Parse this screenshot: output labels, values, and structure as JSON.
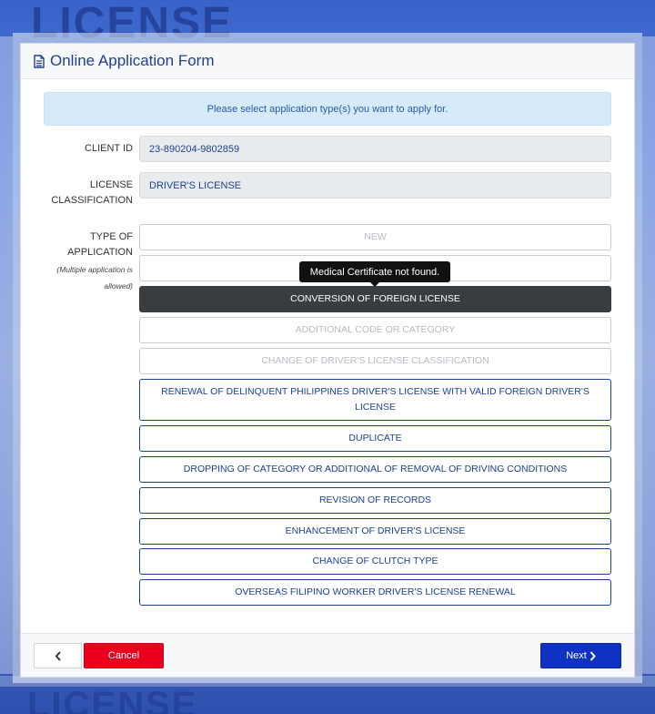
{
  "background": {
    "top_text": "LICENSE",
    "bottom_text": "LICENSE"
  },
  "form": {
    "title": "Online Application Form",
    "title_icon": "file-text-icon",
    "banner": "Please select application type(s) you want to apply for.",
    "client_id_label": "CLIENT ID",
    "client_id_value": "23-890204-9802859",
    "classification_label_1": "LICENSE",
    "classification_label_2": "CLASSIFICATION",
    "classification_value": "DRIVER'S LICENSE",
    "type_label_1": "TYPE OF",
    "type_label_2": "APPLICATION",
    "type_note_1": "(Multiple application is",
    "type_note_2": "allowed)",
    "tooltip": "Medical Certificate not found.",
    "options": [
      {
        "label": "NEW",
        "state": "disabled"
      },
      {
        "label": "",
        "state": "disabled"
      },
      {
        "label": "CONVERSION OF FOREIGN LICENSE",
        "state": "selected"
      },
      {
        "label": "ADDITIONAL CODE OR CATEGORY",
        "state": "disabled"
      },
      {
        "label": "CHANGE OF DRIVER'S LICENSE CLASSIFICATION",
        "state": "disabled"
      },
      {
        "label": "RENEWAL OF DELINQUENT PHILIPPINES DRIVER'S LICENSE WITH VALID FOREIGN DRIVER'S LICENSE",
        "state": "enabled"
      },
      {
        "label": "DUPLICATE",
        "state": "enabled"
      },
      {
        "label": "DROPPING OF CATEGORY OR ADDITIONAL OF REMOVAL OF DRIVING CONDITIONS",
        "state": "enabled"
      },
      {
        "label": "REVISION OF RECORDS",
        "state": "enabled"
      },
      {
        "label": "ENHANCEMENT OF DRIVER'S LICENSE",
        "state": "enabled"
      },
      {
        "label": "CHANGE OF CLUTCH TYPE",
        "state": "enabled"
      },
      {
        "label": "OVERSEAS FILIPINO WORKER DRIVER'S LICENSE RENEWAL",
        "state": "enabled"
      }
    ]
  },
  "footer": {
    "back_icon": "chevron-left-icon",
    "cancel_label": "Cancel",
    "next_label": "Next",
    "next_icon": "chevron-right-icon"
  },
  "colors": {
    "primary": "#0f31c4",
    "danger": "#e8001c",
    "selected": "#3a3d40",
    "text_blue": "#1d3f94",
    "banner_bg": "#d5eafb"
  }
}
